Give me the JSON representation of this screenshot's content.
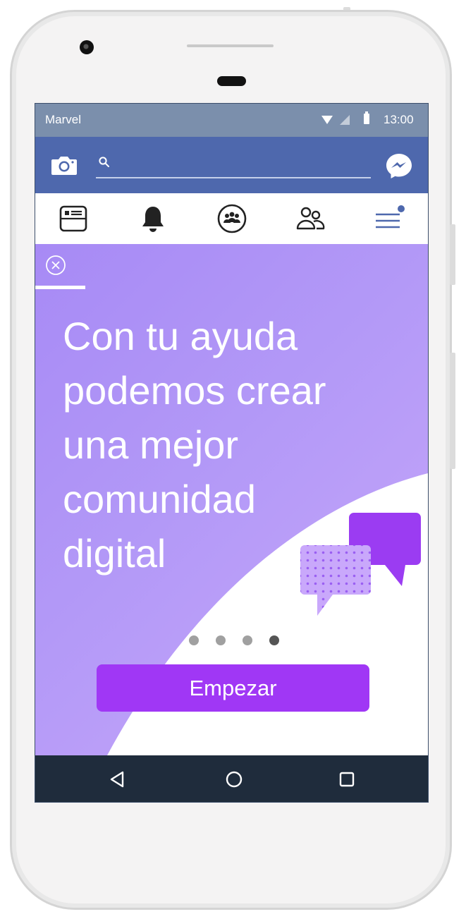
{
  "status_bar": {
    "carrier": "Marvel",
    "time": "13:00"
  },
  "header": {
    "search_placeholder": ""
  },
  "tabs": [
    {
      "name": "feed",
      "icon": "news-feed-icon"
    },
    {
      "name": "notifications",
      "icon": "bell-icon"
    },
    {
      "name": "groups",
      "icon": "groups-icon"
    },
    {
      "name": "friends",
      "icon": "friends-icon"
    },
    {
      "name": "menu",
      "icon": "hamburger-menu-icon"
    }
  ],
  "onboarding": {
    "headline_lines": [
      "Con tu ayuda",
      "podemos crear",
      "una mejor",
      "comunidad",
      "digital"
    ],
    "pager_total": 4,
    "pager_active": 4,
    "button_label": "Empezar"
  },
  "colors": {
    "status_bar": "#7b8fac",
    "header": "#4e68ad",
    "content_bg": "#b399f7",
    "cta": "#a037f5",
    "navbar": "#1f2c3c"
  }
}
